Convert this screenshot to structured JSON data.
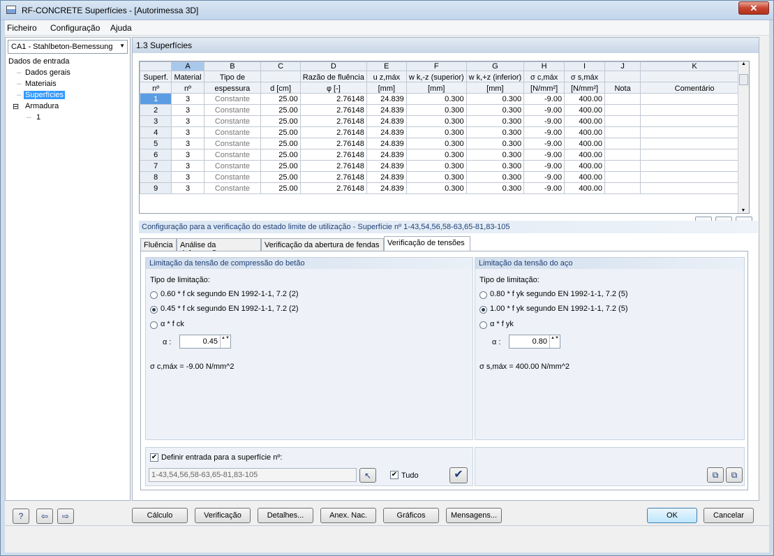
{
  "window": {
    "title": "RF-CONCRETE Superfícies - [Autorimessa 3D]",
    "close": "✕"
  },
  "menu": [
    "Ficheiro",
    "Configuração",
    "Ajuda"
  ],
  "case_combo": "CA1 - Stahlbeton-Bemessung",
  "tree": {
    "root": "Dados de entrada",
    "items": [
      "Dados gerais",
      "Materiais",
      "Superfícies"
    ],
    "armadura": "Armadura",
    "armadura_child": "1",
    "expander": "⊟"
  },
  "section_title": "1.3 Superfícies",
  "grid": {
    "col_letters": [
      "A",
      "B",
      "C",
      "D",
      "E",
      "F",
      "G",
      "H",
      "I",
      "J",
      "K"
    ],
    "hdr1": [
      "Superf.",
      "Material",
      "Tipo de",
      "",
      "Razão de fluência",
      "u z,máx",
      "w k,-z (superior)",
      "w k,+z (inferior)",
      "σ c,máx",
      "σ s,máx",
      "",
      ""
    ],
    "hdr2": [
      "nº",
      "nº",
      "espessura",
      "d [cm]",
      "φ [-]",
      "[mm]",
      "[mm]",
      "[mm]",
      "[N/mm²]",
      "[N/mm²]",
      "Nota",
      "Comentário"
    ],
    "rows": [
      [
        "1",
        "3",
        "Constante",
        "25.00",
        "2.76148",
        "24.839",
        "0.300",
        "0.300",
        "-9.00",
        "400.00",
        "",
        ""
      ],
      [
        "2",
        "3",
        "Constante",
        "25.00",
        "2.76148",
        "24.839",
        "0.300",
        "0.300",
        "-9.00",
        "400.00",
        "",
        ""
      ],
      [
        "3",
        "3",
        "Constante",
        "25.00",
        "2.76148",
        "24.839",
        "0.300",
        "0.300",
        "-9.00",
        "400.00",
        "",
        ""
      ],
      [
        "4",
        "3",
        "Constante",
        "25.00",
        "2.76148",
        "24.839",
        "0.300",
        "0.300",
        "-9.00",
        "400.00",
        "",
        ""
      ],
      [
        "5",
        "3",
        "Constante",
        "25.00",
        "2.76148",
        "24.839",
        "0.300",
        "0.300",
        "-9.00",
        "400.00",
        "",
        ""
      ],
      [
        "6",
        "3",
        "Constante",
        "25.00",
        "2.76148",
        "24.839",
        "0.300",
        "0.300",
        "-9.00",
        "400.00",
        "",
        ""
      ],
      [
        "7",
        "3",
        "Constante",
        "25.00",
        "2.76148",
        "24.839",
        "0.300",
        "0.300",
        "-9.00",
        "400.00",
        "",
        ""
      ],
      [
        "8",
        "3",
        "Constante",
        "25.00",
        "2.76148",
        "24.839",
        "0.300",
        "0.300",
        "-9.00",
        "400.00",
        "",
        ""
      ],
      [
        "9",
        "3",
        "Constante",
        "25.00",
        "2.76148",
        "24.839",
        "0.300",
        "0.300",
        "-9.00",
        "400.00",
        "",
        ""
      ]
    ],
    "selected_row": 1
  },
  "grid_tools": {
    "filter": "▼",
    "view": "◉",
    "pick": "↖"
  },
  "config_title": "Configuração para a verificação do estado limite de utilização - Superfície nº 1-43,54,56,58-63,65-81,83-105",
  "tabs": [
    "Fluência",
    "Análise da deformação",
    "Verificação da abertura de fendas",
    "Verificação de tensões"
  ],
  "concrete": {
    "title": "Limitação da tensão de compressão do betão",
    "type_label": "Tipo de limitação:",
    "opt1": "0.60 * f ck segundo EN 1992-1-1, 7.2 (2)",
    "opt2": "0.45 * f ck segundo EN 1992-1-1, 7.2 (2)",
    "opt3": "α * f ck",
    "selected": 2,
    "alpha_label": "α :",
    "alpha_value": "0.45",
    "result": "σ c,máx = -9.00 N/mm^2"
  },
  "steel": {
    "title": "Limitação da tensão do aço",
    "type_label": "Tipo de limitação:",
    "opt1": "0.80 * f yk segundo EN 1992-1-1, 7.2 (5)",
    "opt2": "1.00 * f yk segundo EN 1992-1-1, 7.2 (5)",
    "opt3": "α * f yk",
    "selected": 2,
    "alpha_label": "α :",
    "alpha_value": "0.80",
    "result": "σ s,máx = 400.00 N/mm^2"
  },
  "define": {
    "label": "Definir entrada para a superfície nº:",
    "value": "1-43,54,56,58-63,65-81,83-105",
    "tudo": "Tudo",
    "checkmark": "✔"
  },
  "bottom_buttons": [
    "Cálculo",
    "Verificação",
    "Detalhes...",
    "Anex. Nac.",
    "Gráficos",
    "Mensagens..."
  ],
  "ok": "OK",
  "cancel": "Cancelar",
  "icons": {
    "help": "?",
    "import": "⇦",
    "export": "⇨",
    "copy1": "⧉",
    "copy2": "⧉",
    "updown": "▲▼",
    "combo_arrow": "▼",
    "scroll_up": "▲",
    "scroll_down": "▼"
  }
}
